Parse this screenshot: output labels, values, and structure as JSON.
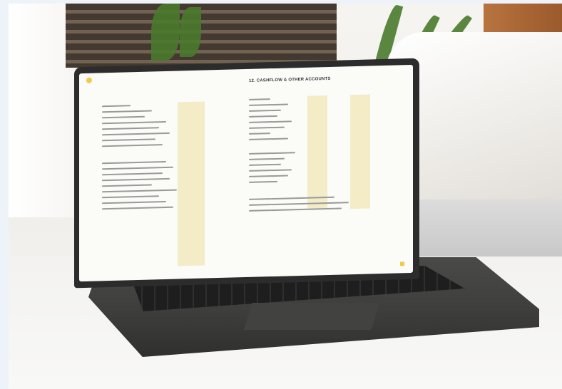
{
  "scene": {
    "description_tags": [
      "laptop",
      "spreadsheet-on-screen",
      "indoor",
      "lounge-chair",
      "plant"
    ],
    "colors": {
      "accent_yellow": "#f2c84b",
      "laptop_body": "#3c3c3a",
      "screen_bg": "#fbfbf8"
    }
  },
  "screen": {
    "heading": "12. CASHFLOW & OTHER ACCOUNTS"
  }
}
